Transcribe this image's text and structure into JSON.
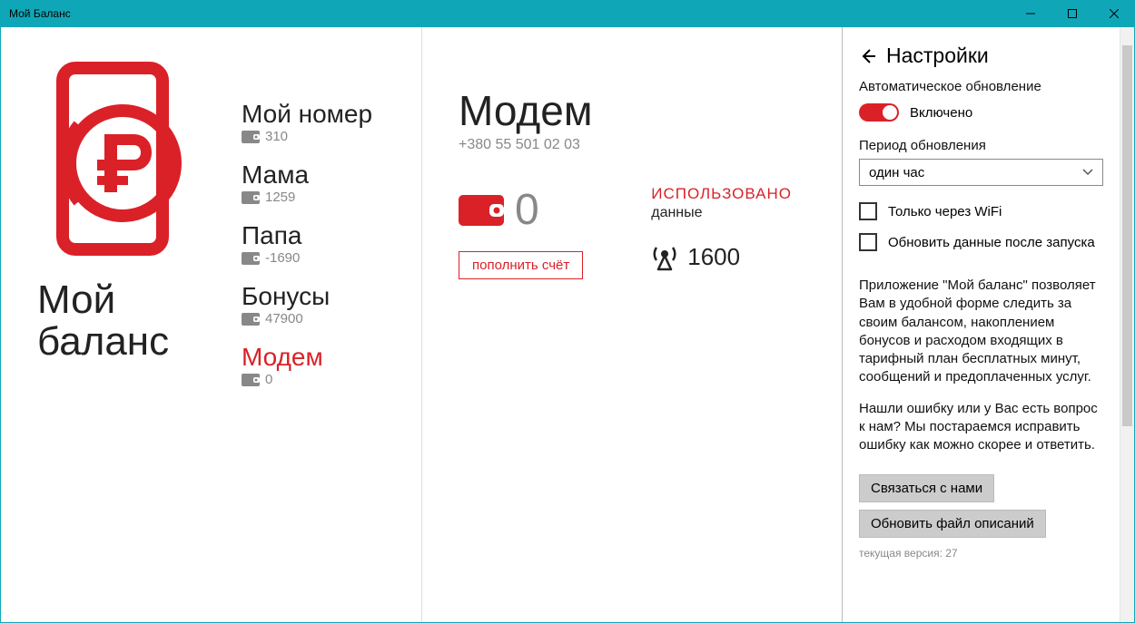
{
  "window": {
    "title": "Мой Баланс"
  },
  "app": {
    "name_line1": "Мой",
    "name_line2": "баланс"
  },
  "accounts": [
    {
      "name": "Мой номер",
      "balance": "310"
    },
    {
      "name": "Мама",
      "balance": "1259"
    },
    {
      "name": "Папа",
      "balance": "-1690"
    },
    {
      "name": "Бонусы",
      "balance": "47900"
    },
    {
      "name": "Модем",
      "balance": "0"
    }
  ],
  "detail": {
    "title": "Модем",
    "phone": "+380 55 501 02 03",
    "balance": "0",
    "topup_label": "пополнить счёт",
    "used_label": "ИСПОЛЬЗОВАНО",
    "used_sub": "данные",
    "used_value": "1600"
  },
  "settings": {
    "title": "Настройки",
    "auto_update_label": "Автоматическое обновление",
    "auto_update_state": "Включено",
    "period_label": "Период обновления",
    "period_value": "один час",
    "wifi_only": "Только через WiFi",
    "update_on_launch": "Обновить данные после запуска",
    "desc1": "Приложение \"Мой баланс\" позволяет Вам в удобной форме следить за своим балансом, накоплением бонусов и расходом входящих в тарифный план бесплатных минут, сообщений и предоплаченных услуг.",
    "desc2": "Нашли ошибку или у Вас есть вопрос к нам? Мы постараемся исправить ошибку как можно скорее и ответить.",
    "contact_btn": "Связаться с нами",
    "update_defs_btn": "Обновить файл описаний",
    "version_label": "текущая версия: 27"
  }
}
